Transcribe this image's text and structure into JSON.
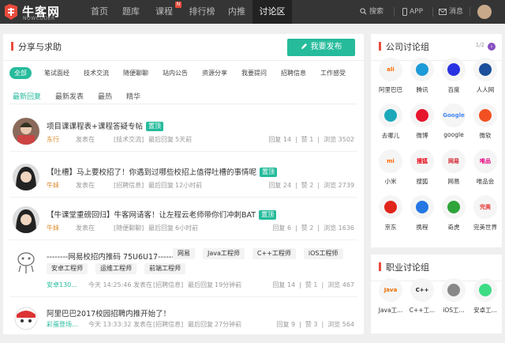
{
  "nav": {
    "logo_cn": "牛客网",
    "logo_en": "NOWCODER",
    "items": [
      {
        "label": "首页"
      },
      {
        "label": "题库"
      },
      {
        "label": "课程",
        "badge": "N"
      },
      {
        "label": "排行榜"
      },
      {
        "label": "内推"
      },
      {
        "label": "讨论区"
      }
    ],
    "search": "搜索",
    "app": "APP",
    "messages": "消息",
    "colors": {
      "bar": "#353535",
      "accent": "#25bb9b",
      "red": "#e94b3c"
    }
  },
  "main": {
    "title": "分享与求助",
    "post_button": "我要发布",
    "tags": [
      "全部",
      "笔试面经",
      "技术交流",
      "随便聊聊",
      "站内公告",
      "资源分享",
      "我要提问",
      "招聘信息",
      "工作感受"
    ],
    "sorts": [
      "最新回复",
      "最新发表",
      "最热",
      "精华"
    ],
    "posts": [
      {
        "title": "项目课课程表+课程答疑专帖",
        "badge": "置顶",
        "user": "东行",
        "posted_label": "发表在",
        "category": "[技术交流]",
        "last_label": "最后回复",
        "last_time": "5天前",
        "stats": {
          "reply": "回复 14",
          "sep1": "|",
          "likes": "赞 1",
          "sep2": "|",
          "views": "浏览 3502"
        }
      },
      {
        "title": "【吐槽】马上要校招了！你遇到过哪些校招上值得吐槽的事情呢",
        "badge": "置顶",
        "user": "牛妹",
        "posted_label": "发表在",
        "category": "[招聘信息]",
        "last_label": "最后回复",
        "last_time": "12小时前",
        "stats": {
          "reply": "回复 24",
          "sep1": "|",
          "likes": "赞 2",
          "sep2": "|",
          "views": "浏览 2739"
        }
      },
      {
        "title": "【牛课堂重磅回归】牛客网请客！让左程云老师带你们冲刺BAT",
        "badge": "置顶",
        "user": "牛妹",
        "posted_label": "发表在",
        "category": "[随便聊聊]",
        "last_label": "最后回复",
        "last_time": "6小时前",
        "stats": {
          "reply": "回复 6",
          "sep1": "|",
          "likes": "赞 2",
          "sep2": "|",
          "views": "浏览 1636"
        }
      },
      {
        "title_line1": "--------网易校招内推码 75U6U17--------",
        "tags_line1": [
          "网易",
          "Java工程师",
          "C++工程师",
          "iOS工程师"
        ],
        "tags_line2": [
          "安卓工程师",
          "运维工程师",
          "前端工程师"
        ],
        "user": "安卓130...",
        "date": "今天 14:25:46",
        "posted_label": "发表在",
        "category": "[招聘信息]",
        "last_label": "最后回复",
        "last_time": "19分钟前",
        "stats": {
          "reply": "回复 14",
          "sep1": "|",
          "likes": "赞 1",
          "sep2": "|",
          "views": "浏览 467"
        }
      },
      {
        "title": "阿里巴巴2017校园招聘内推开始了！",
        "user": "彩蛋登场...",
        "date": "今天 13:33:32",
        "posted_label": "发表在",
        "category": "[招聘信息]",
        "last_label": "最后回复",
        "last_time": "27分钟前",
        "stats": {
          "reply": "回复 9",
          "sep1": "|",
          "likes": "赞 3",
          "sep2": "|",
          "views": "浏览 564"
        }
      }
    ]
  },
  "companies": {
    "title": "公司讨论组",
    "pager": "1/2",
    "pager_next": "›",
    "items": [
      {
        "label": "阿里巴巴",
        "icon": "alibaba-icon",
        "color": "#ff6a00",
        "text": "ali"
      },
      {
        "label": "腾讯",
        "icon": "tencent-icon",
        "color": "#1c9bd8",
        "text": ""
      },
      {
        "label": "百度",
        "icon": "baidu-icon",
        "color": "#2932e1",
        "text": ""
      },
      {
        "label": "人人网",
        "icon": "renren-icon",
        "color": "#1b4f9c",
        "text": ""
      },
      {
        "label": "去哪儿",
        "icon": "qunar-icon",
        "color": "#1ba9ba",
        "text": ""
      },
      {
        "label": "微博",
        "icon": "weibo-icon",
        "color": "#e6162d",
        "text": ""
      },
      {
        "label": "google",
        "icon": "google-icon",
        "color": "#4285f4",
        "text": "Google"
      },
      {
        "label": "微软",
        "icon": "microsoft-icon",
        "color": "#f25022",
        "text": ""
      },
      {
        "label": "小米",
        "icon": "xiaomi-icon",
        "color": "#ff6700",
        "text": "mi"
      },
      {
        "label": "搜狐",
        "icon": "sohu-icon",
        "color": "#e60012",
        "text": "搜狐"
      },
      {
        "label": "网易",
        "icon": "netease-icon",
        "color": "#d2222d",
        "text": "网易"
      },
      {
        "label": "唯品会",
        "icon": "vip-icon",
        "color": "#e4007f",
        "text": "唯品"
      },
      {
        "label": "京东",
        "icon": "jd-icon",
        "color": "#e1251b",
        "text": ""
      },
      {
        "label": "携程",
        "icon": "ctrip-icon",
        "color": "#2577e3",
        "text": ""
      },
      {
        "label": "奇虎",
        "icon": "qihoo-icon",
        "color": "#2ea43a",
        "text": ""
      },
      {
        "label": "完美世界",
        "icon": "perfect-world-icon",
        "color": "#e53935",
        "text": "完美"
      }
    ]
  },
  "careers": {
    "title": "职业讨论组",
    "items": [
      {
        "label": "Java工...",
        "icon": "java-icon",
        "color": "#e76f00",
        "text": "Java"
      },
      {
        "label": "C++工...",
        "icon": "cpp-icon",
        "color": "#222222",
        "text": "C++"
      },
      {
        "label": "iOS工...",
        "icon": "apple-icon",
        "color": "#888888",
        "text": ""
      },
      {
        "label": "安卓工...",
        "icon": "android-icon",
        "color": "#3ddc84",
        "text": ""
      }
    ]
  }
}
